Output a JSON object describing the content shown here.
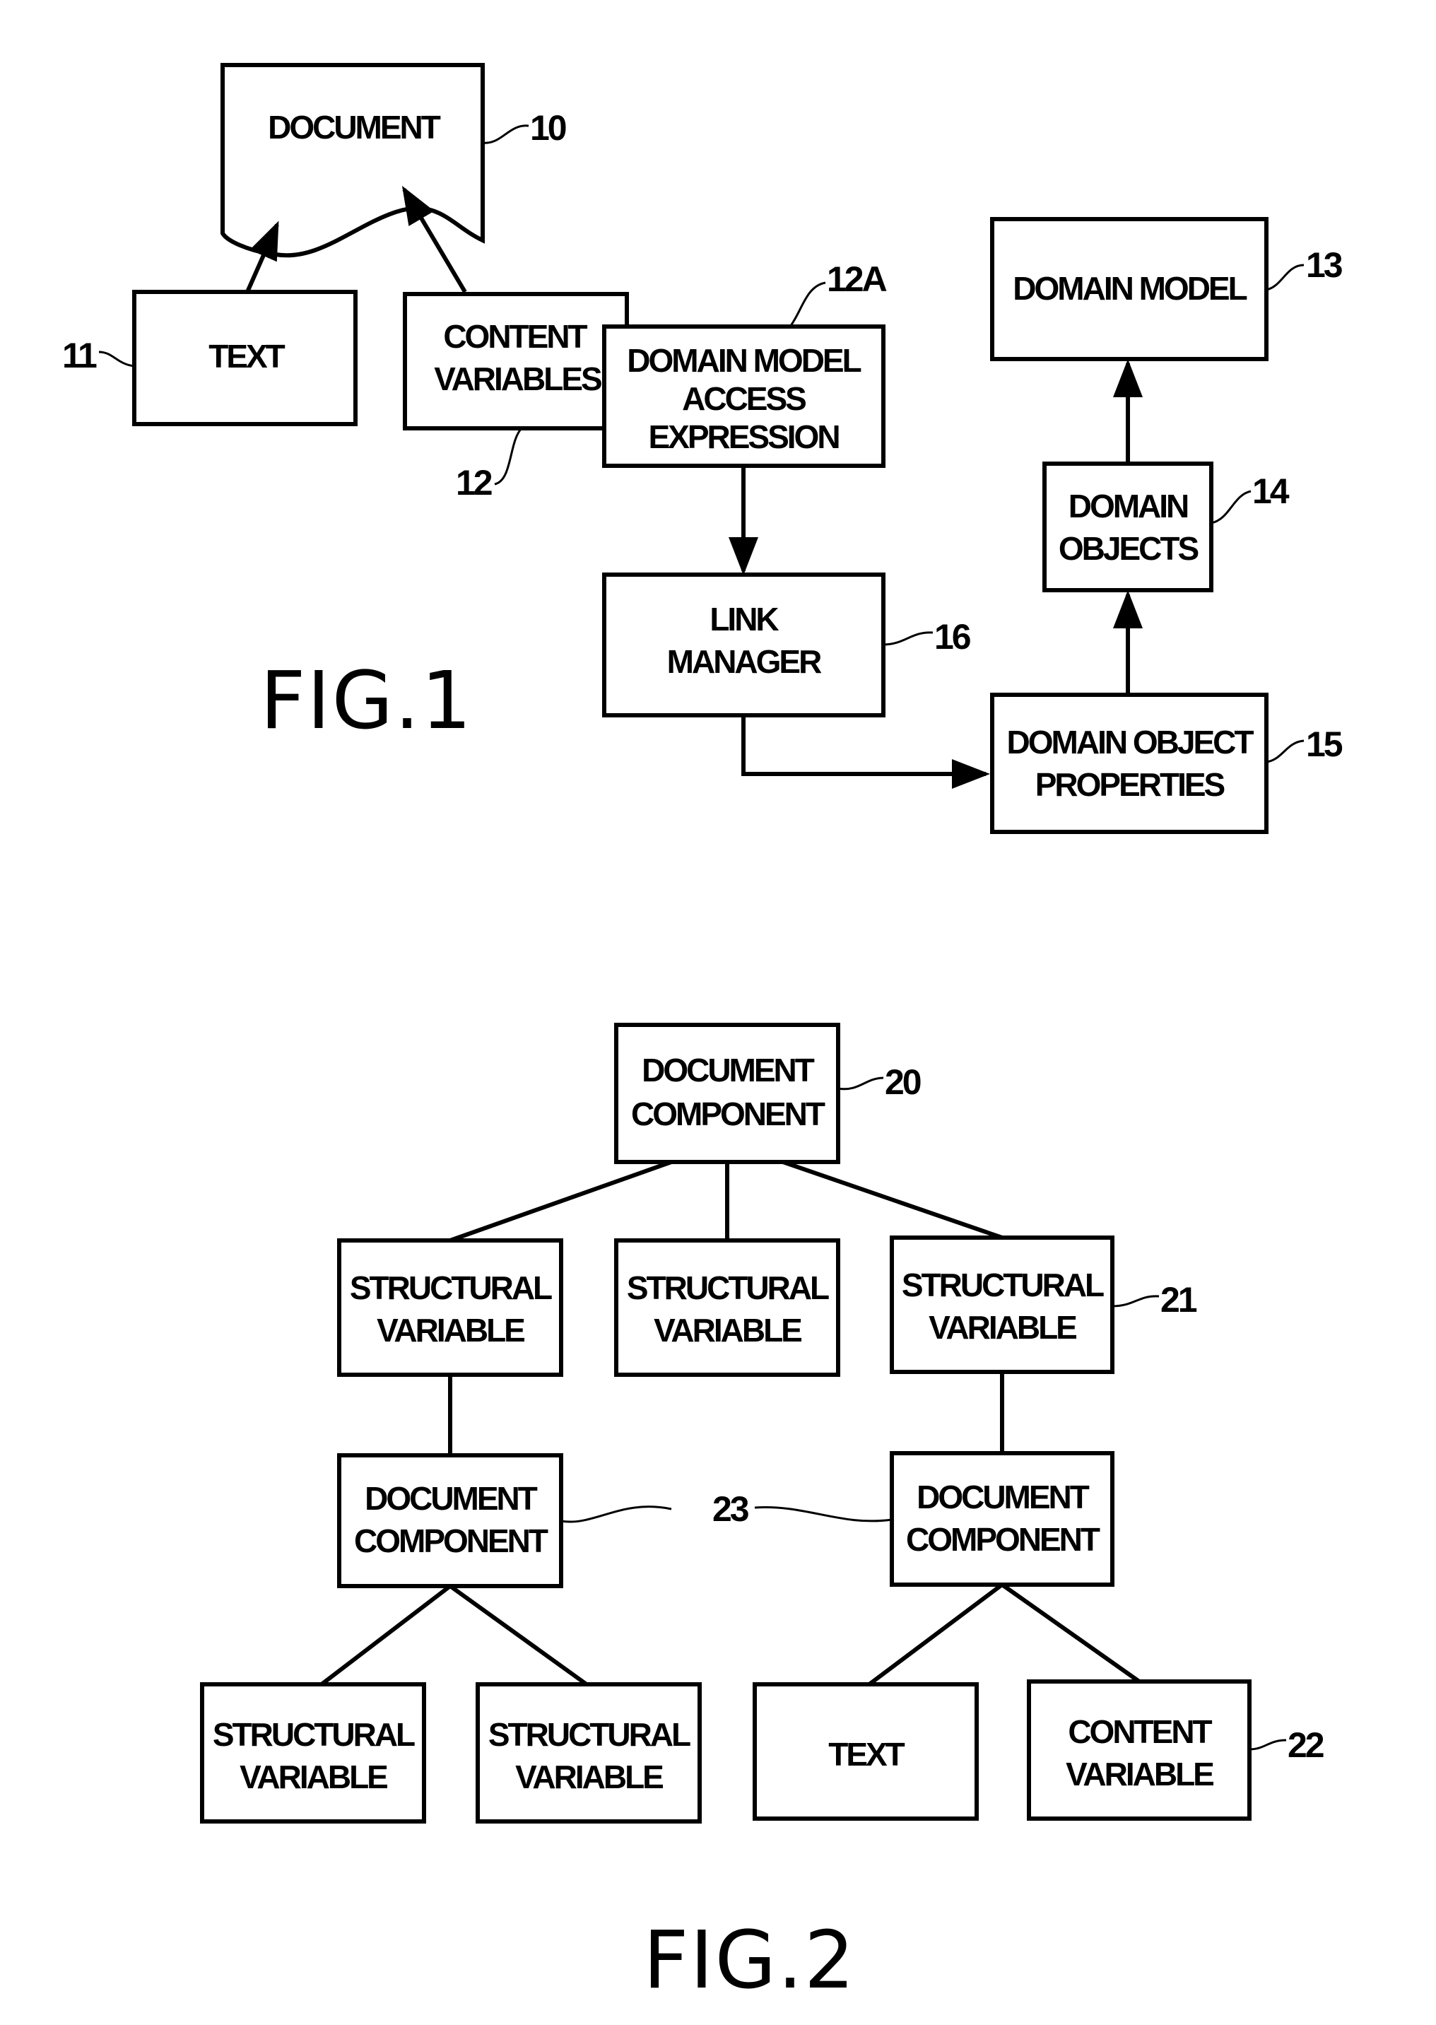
{
  "fig1": {
    "caption": "FIG.1",
    "document": {
      "label": "DOCUMENT",
      "ref": "10"
    },
    "text": {
      "label": "TEXT",
      "ref": "11"
    },
    "content_variables": {
      "line1": "CONTENT",
      "line2": "VARIABLES",
      "ref": "12"
    },
    "dmae": {
      "line1": "DOMAIN MODEL",
      "line2": "ACCESS",
      "line3": "EXPRESSION",
      "ref": "12A"
    },
    "domain_model": {
      "label": "DOMAIN MODEL",
      "ref": "13"
    },
    "domain_objects": {
      "line1": "DOMAIN",
      "line2": "OBJECTS",
      "ref": "14"
    },
    "domain_object_properties": {
      "line1": "DOMAIN OBJECT",
      "line2": "PROPERTIES",
      "ref": "15"
    },
    "link_manager": {
      "line1": "LINK",
      "line2": "MANAGER",
      "ref": "16"
    }
  },
  "fig2": {
    "caption": "FIG.2",
    "root": {
      "line1": "DOCUMENT",
      "line2": "COMPONENT",
      "ref": "20"
    },
    "sv_left": {
      "line1": "STRUCTURAL",
      "line2": "VARIABLE"
    },
    "sv_mid": {
      "line1": "STRUCTURAL",
      "line2": "VARIABLE"
    },
    "sv_right": {
      "line1": "STRUCTURAL",
      "line2": "VARIABLE",
      "ref": "21"
    },
    "dc_left": {
      "line1": "DOCUMENT",
      "line2": "COMPONENT"
    },
    "dc_right": {
      "line1": "DOCUMENT",
      "line2": "COMPONENT"
    },
    "dc_ref": "23",
    "leaf1": {
      "line1": "STRUCTURAL",
      "line2": "VARIABLE"
    },
    "leaf2": {
      "line1": "STRUCTURAL",
      "line2": "VARIABLE"
    },
    "leaf3": {
      "label": "TEXT"
    },
    "leaf4": {
      "line1": "CONTENT",
      "line2": "VARIABLE",
      "ref": "22"
    }
  }
}
